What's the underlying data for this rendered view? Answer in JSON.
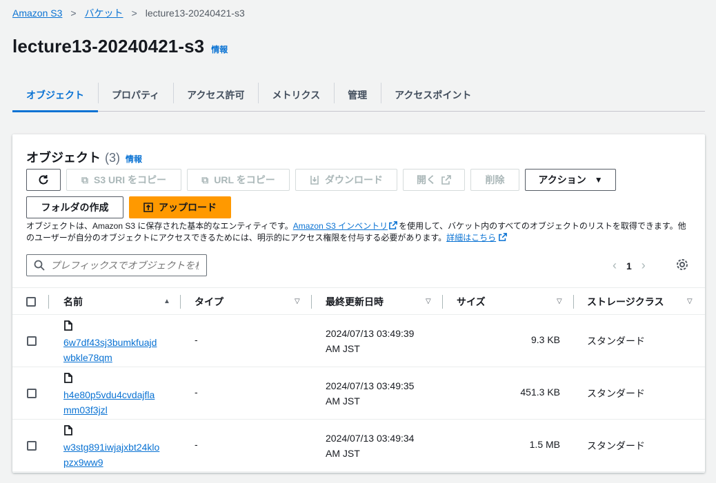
{
  "breadcrumb": {
    "items": [
      "Amazon S3",
      "バケット"
    ],
    "current": "lecture13-20240421-s3"
  },
  "page": {
    "title": "lecture13-20240421-s3",
    "info": "情報"
  },
  "tabs": [
    "オブジェクト",
    "プロパティ",
    "アクセス許可",
    "メトリクス",
    "管理",
    "アクセスポイント"
  ],
  "active_tab": "オブジェクト",
  "panel": {
    "title": "オブジェクト",
    "count": "(3)",
    "info": "情報",
    "buttons": {
      "copy_s3_uri": "S3 URI をコピー",
      "copy_url": "URL をコピー",
      "download": "ダウンロード",
      "open": "開く",
      "delete": "削除",
      "actions": "アクション",
      "create_folder": "フォルダの作成",
      "upload": "アップロード"
    },
    "description": {
      "part1": "オブジェクトは、Amazon S3 に保存された基本的なエンティティです。",
      "link1": "Amazon S3 インベントリ",
      "part2": "を使用して、バケット内のすべてのオブジェクトのリストを取得できます。他のユーザーが自分のオブジェクトにアクセスできるためには、明示的にアクセス権限を付与する必要があります。",
      "link2": "詳細はこちら"
    },
    "search_placeholder": "プレフィックスでオブジェクトを検索",
    "page_number": "1"
  },
  "table": {
    "columns": [
      "名前",
      "タイプ",
      "最終更新日時",
      "サイズ",
      "ストレージクラス"
    ],
    "rows": [
      {
        "name_line1": "6w7df43sj3bumkfuajd",
        "name_line2": "wbkle78qm",
        "type": "-",
        "date_line1": "2024/07/13 03:49:39",
        "date_line2": "AM JST",
        "size": "9.3 KB",
        "storage_class": "スタンダード"
      },
      {
        "name_line1": "h4e80p5vdu4cvdajfla",
        "name_line2": "mm03f3jzl",
        "type": "-",
        "date_line1": "2024/07/13 03:49:35",
        "date_line2": "AM JST",
        "size": "451.3 KB",
        "storage_class": "スタンダード"
      },
      {
        "name_line1": "w3stg891iwjajxbt24klo",
        "name_line2": "pzx9ww9",
        "type": "-",
        "date_line1": "2024/07/13 03:49:34",
        "date_line2": "AM JST",
        "size": "1.5 MB",
        "storage_class": "スタンダード"
      }
    ]
  },
  "colors": {
    "link": "#0972d3",
    "primary_button": "#ff9900",
    "background": "#f2f3f3"
  },
  "icons": [
    "refresh-icon",
    "copy-icon",
    "download-icon",
    "external-link-icon",
    "caret-down-icon",
    "upload-icon",
    "search-icon",
    "chevron-left-icon",
    "chevron-right-icon",
    "gear-icon",
    "file-icon",
    "sort-ascending-icon",
    "sort-icon"
  ]
}
